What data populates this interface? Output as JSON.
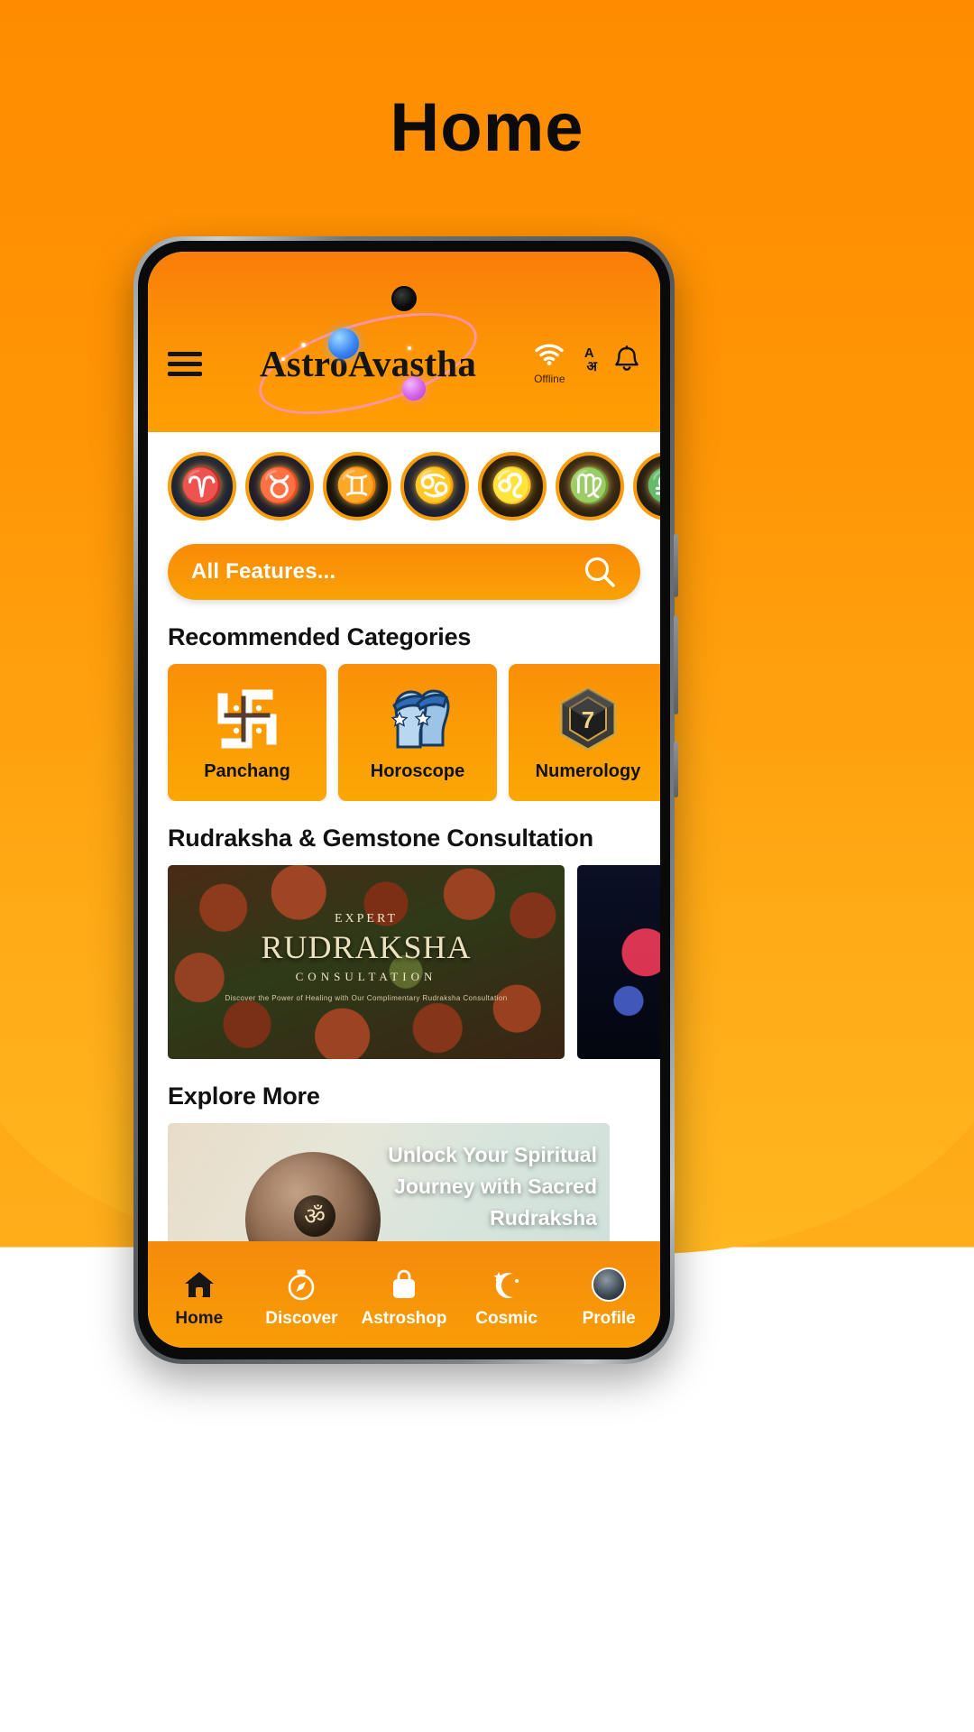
{
  "poster": {
    "title": "Home",
    "bg_color_top": "#FF8C00",
    "bg_color_bottom": "#FFB61F"
  },
  "phone": {
    "status_bar": {
      "time": "",
      "right": ""
    }
  },
  "app": {
    "header": {
      "menu_icon": "hamburger-menu-icon",
      "brand": "AstroAvastha",
      "wifi_icon": "wifi-icon",
      "wifi_label": "Offline",
      "language_icon_line1": "A",
      "language_icon_line2": "अ",
      "notification_icon": "bell-icon",
      "accent": "#F9900A"
    },
    "zodiac": {
      "items": [
        {
          "name": "Aries",
          "glyph": "♈"
        },
        {
          "name": "Taurus",
          "glyph": "♉"
        },
        {
          "name": "Gemini",
          "glyph": "♊"
        },
        {
          "name": "Cancer",
          "glyph": "♋"
        },
        {
          "name": "Leo",
          "glyph": "♌"
        },
        {
          "name": "Virgo",
          "glyph": "♍"
        },
        {
          "name": "Libra",
          "glyph": "♎"
        }
      ]
    },
    "search": {
      "value": "All Features...",
      "placeholder": "All Features...",
      "icon": "search-icon"
    },
    "recommended": {
      "title": "Recommended Categories",
      "cards": [
        {
          "label": "Panchang",
          "icon": "swastika-icon"
        },
        {
          "label": "Horoscope",
          "icon": "gemini-twins-icon"
        },
        {
          "label": "Numerology",
          "icon": "dice-seven-icon"
        }
      ]
    },
    "rudraksha": {
      "title": "Rudraksha & Gemstone Consultation",
      "banner": {
        "eyebrow": "EXPERT",
        "headline": "RUDRAKSHA",
        "subline": "CONSULTATION",
        "tagline": "Discover the Power of Healing with Our Complimentary Rudraksha Consultation"
      },
      "banner2_name": "gemstone-banner"
    },
    "explore": {
      "title": "Explore More",
      "headline": "Unlock Your Spiritual Journey with Sacred Rudraksha",
      "om_glyph": "ॐ"
    },
    "bottom_nav": {
      "items": [
        {
          "label": "Home",
          "icon": "home-icon",
          "active": true
        },
        {
          "label": "Discover",
          "icon": "compass-icon",
          "active": false
        },
        {
          "label": "Astroshop",
          "icon": "shopping-bag-icon",
          "active": false
        },
        {
          "label": "Cosmic",
          "icon": "moon-star-icon",
          "active": false
        },
        {
          "label": "Profile",
          "icon": "avatar-icon",
          "active": false
        }
      ]
    }
  }
}
